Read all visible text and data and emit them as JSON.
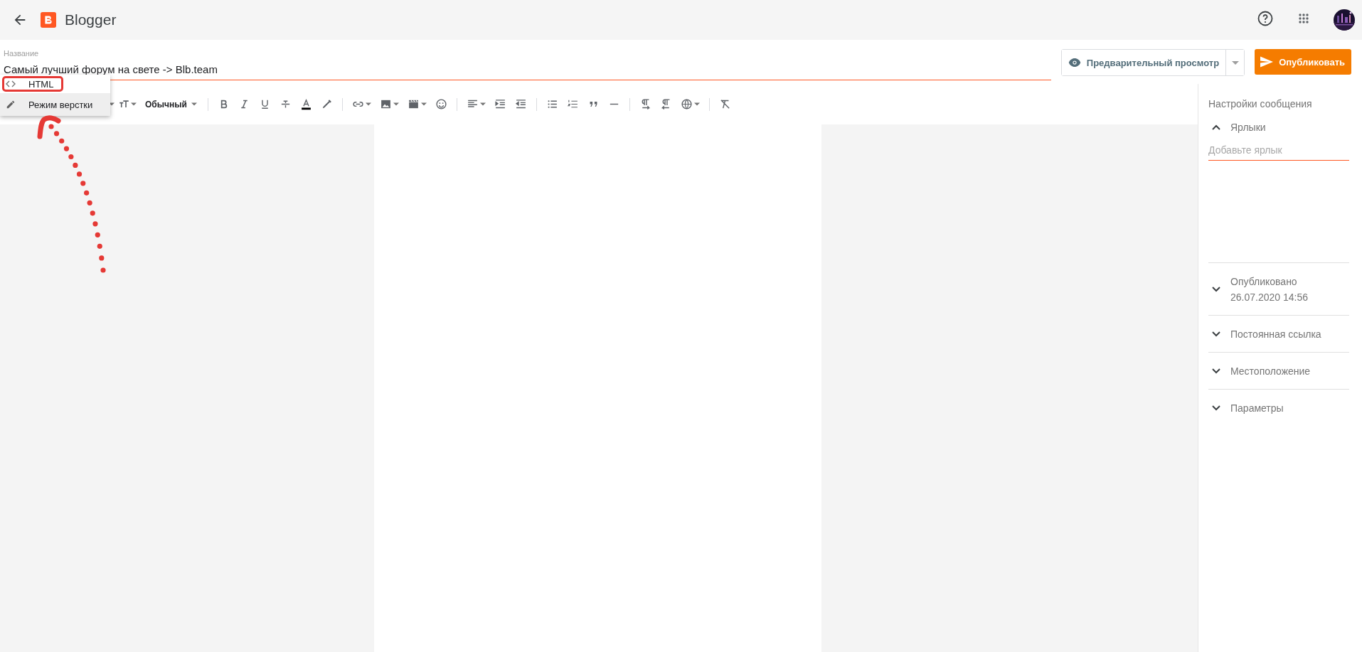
{
  "app": {
    "name": "Blogger"
  },
  "post": {
    "title_label": "Название",
    "title": "Самый лучший форум на свете -> Blb.team"
  },
  "actions": {
    "preview": "Предварительный просмотр",
    "publish": "Опубликовать"
  },
  "mode_menu": {
    "items": [
      {
        "label": "HTML",
        "kind": "code",
        "selected": false,
        "circled": true
      },
      {
        "label": "Режим верстки",
        "kind": "pencil",
        "selected": true,
        "circled": false
      }
    ]
  },
  "toolbar": {
    "paragraph_style": "Обычный"
  },
  "settings": {
    "title": "Настройки сообщения",
    "sections": [
      {
        "label": "Ярлыки",
        "expanded": true,
        "placeholder": "Добавьте ярлык"
      },
      {
        "label": "Опубликовано",
        "expanded": false,
        "detail": "26.07.2020 14:56"
      },
      {
        "label": "Постоянная ссылка",
        "expanded": false
      },
      {
        "label": "Местоположение",
        "expanded": false
      },
      {
        "label": "Параметры",
        "expanded": false
      }
    ]
  }
}
